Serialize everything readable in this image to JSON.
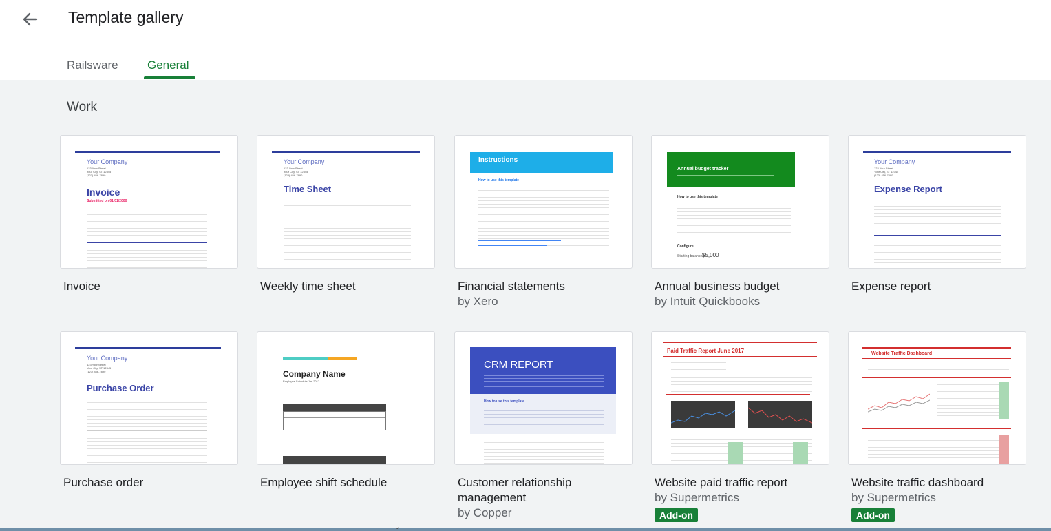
{
  "header": {
    "title": "Template gallery",
    "tabs": [
      {
        "label": "Railsware",
        "active": false
      },
      {
        "label": "General",
        "active": true
      }
    ]
  },
  "section": {
    "title": "Work"
  },
  "templates": [
    {
      "title": "Invoice",
      "subtitle": "",
      "addon": ""
    },
    {
      "title": "Weekly time sheet",
      "subtitle": "",
      "addon": ""
    },
    {
      "title": "Financial statements",
      "subtitle": "by Xero",
      "addon": ""
    },
    {
      "title": "Annual business budget",
      "subtitle": "by Intuit Quickbooks",
      "addon": ""
    },
    {
      "title": "Expense report",
      "subtitle": "",
      "addon": ""
    },
    {
      "title": "Purchase order",
      "subtitle": "",
      "addon": ""
    },
    {
      "title": "Employee shift schedule",
      "subtitle": "",
      "addon": ""
    },
    {
      "title": "Customer relationship management",
      "subtitle": "by Copper",
      "addon": ""
    },
    {
      "title": "Website paid traffic report",
      "subtitle": "by Supermetrics",
      "addon": "Add-on"
    },
    {
      "title": "Website traffic dashboard",
      "subtitle": "by Supermetrics",
      "addon": "Add-on"
    }
  ],
  "thumbs": {
    "company": "Your Company",
    "invoice": {
      "heading": "Invoice",
      "submitted": "Submitted on 01/01/2000"
    },
    "timesheet": {
      "heading": "Time Sheet"
    },
    "instructions": {
      "heading": "Instructions",
      "howto": "How to use this template",
      "configure_label": "Starting balance:",
      "configure_value": "$5,000"
    },
    "budget": {
      "heading": "Annual budget tracker",
      "howto": "How to use this template",
      "configure": "Configure"
    },
    "expense": {
      "heading": "Expense Report"
    },
    "purchase": {
      "heading": "Purchase Order"
    },
    "shift": {
      "heading": "Company Name",
      "sub": "Employee Schedule Jan 2017"
    },
    "crm": {
      "heading": "CRM REPORT",
      "howto": "How to use this template"
    },
    "paid": {
      "heading": "Paid Traffic Report June 2017"
    },
    "dash": {
      "heading": "Website Traffic Dashboard"
    }
  },
  "colors": {
    "accent": "#188038",
    "invoice_blue": "#2d3e9c",
    "instructions_blue": "#1eaee8",
    "budget_green": "#138a1e",
    "crm_blue": "#3b4fbf",
    "report_red": "#d32f2f"
  }
}
